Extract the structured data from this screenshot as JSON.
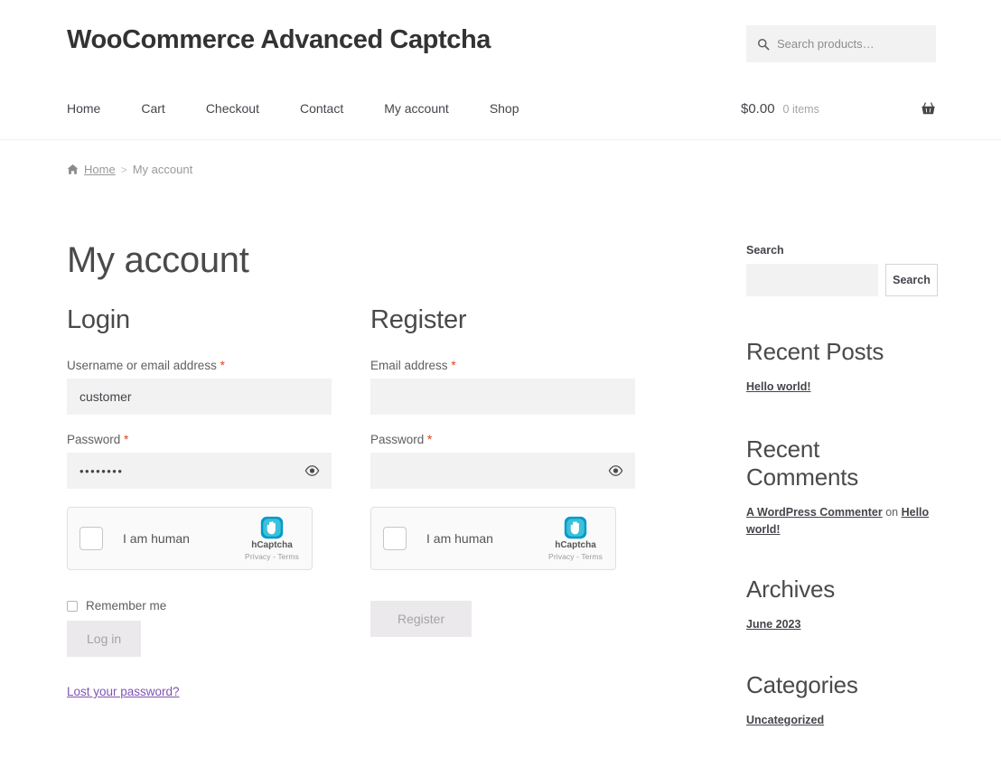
{
  "header": {
    "site_title": "WooCommerce Advanced Captcha",
    "product_search": {
      "placeholder": "Search products…",
      "value": "",
      "icon": "search-icon"
    },
    "nav": [
      {
        "label": "Home"
      },
      {
        "label": "Cart"
      },
      {
        "label": "Checkout"
      },
      {
        "label": "Contact"
      },
      {
        "label": "My account"
      },
      {
        "label": "Shop"
      }
    ],
    "cart": {
      "total": "$0.00",
      "items": "0 items",
      "icon": "shopping-basket-icon"
    }
  },
  "breadcrumb": {
    "home_icon": "home-icon",
    "home": "Home",
    "separator": ">",
    "current": "My account"
  },
  "main": {
    "page_title": "My account",
    "login": {
      "title": "Login",
      "username": {
        "label": "Username or email address",
        "required": "*",
        "value": "customer",
        "placeholder": ""
      },
      "password": {
        "label": "Password",
        "required": "*",
        "value": "••••••••",
        "placeholder": "",
        "toggle_icon": "eye-icon"
      },
      "captcha": {
        "checkbox_label": "I am human",
        "brand": "hCaptcha",
        "terms": "Privacy - Terms",
        "logo_icon": "hcaptcha-hand-icon"
      },
      "remember_label": "Remember me",
      "submit_label": "Log in",
      "lost_password": "Lost your password?"
    },
    "register": {
      "title": "Register",
      "email": {
        "label": "Email address",
        "required": "*",
        "value": "",
        "placeholder": ""
      },
      "password": {
        "label": "Password",
        "required": "*",
        "value": "",
        "placeholder": "",
        "toggle_icon": "eye-icon"
      },
      "captcha": {
        "checkbox_label": "I am human",
        "brand": "hCaptcha",
        "terms": "Privacy - Terms",
        "logo_icon": "hcaptcha-hand-icon"
      },
      "submit_label": "Register"
    }
  },
  "sidebar": {
    "search": {
      "label": "Search",
      "value": "",
      "placeholder": "",
      "button_label": "Search"
    },
    "recent_posts": {
      "title": "Recent Posts",
      "items": [
        {
          "label": "Hello world!"
        }
      ]
    },
    "recent_comments": {
      "title": "Recent Comments",
      "items": [
        {
          "author": "A WordPress Commenter",
          "connector": "on",
          "post": "Hello world!"
        }
      ]
    },
    "archives": {
      "title": "Archives",
      "items": [
        {
          "label": "June 2023"
        }
      ]
    },
    "categories": {
      "title": "Categories",
      "items": [
        {
          "label": "Uncategorized"
        }
      ]
    }
  },
  "colors": {
    "required_asterisk": "#e2401c",
    "link_purple": "#7f54b3",
    "field_bg": "#f2f2f2",
    "button_bg": "#ebe9eb",
    "hcaptcha_teal": "#00a0b4"
  }
}
